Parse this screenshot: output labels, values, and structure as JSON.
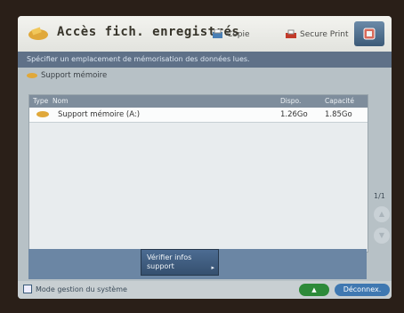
{
  "header": {
    "title": "Accès fich. enregistrés",
    "tabs": [
      {
        "label": "Copie",
        "icon": "copy-icon"
      },
      {
        "label": "Secure Print",
        "icon": "secure-print-icon"
      }
    ],
    "menu_icon": "menu-icon"
  },
  "instruction": "Spécifier un emplacement de mémorisation des données lues.",
  "location": {
    "label": "Support mémoire",
    "icon": "memory-media-icon"
  },
  "table": {
    "columns": [
      "Type",
      "Nom",
      "Dispo.",
      "Capacité"
    ],
    "rows": [
      {
        "name": "Support mémoire (A:)",
        "available": "1.26Go",
        "capacity": "1.85Go",
        "icon": "memory-media-icon"
      }
    ]
  },
  "actions": {
    "verify_label_line1": "Vérifier infos",
    "verify_label_line2": "support"
  },
  "pager": {
    "text": "1/1",
    "up_icon": "scroll-up-icon",
    "down_icon": "scroll-down-icon"
  },
  "footer": {
    "system_mode": "Mode gestion du système",
    "up_button": "▲",
    "logout_label": "Déconnex."
  },
  "colors": {
    "accent": "#3f78b1",
    "header_bar": "#5f7188",
    "green": "#2d8a39"
  }
}
